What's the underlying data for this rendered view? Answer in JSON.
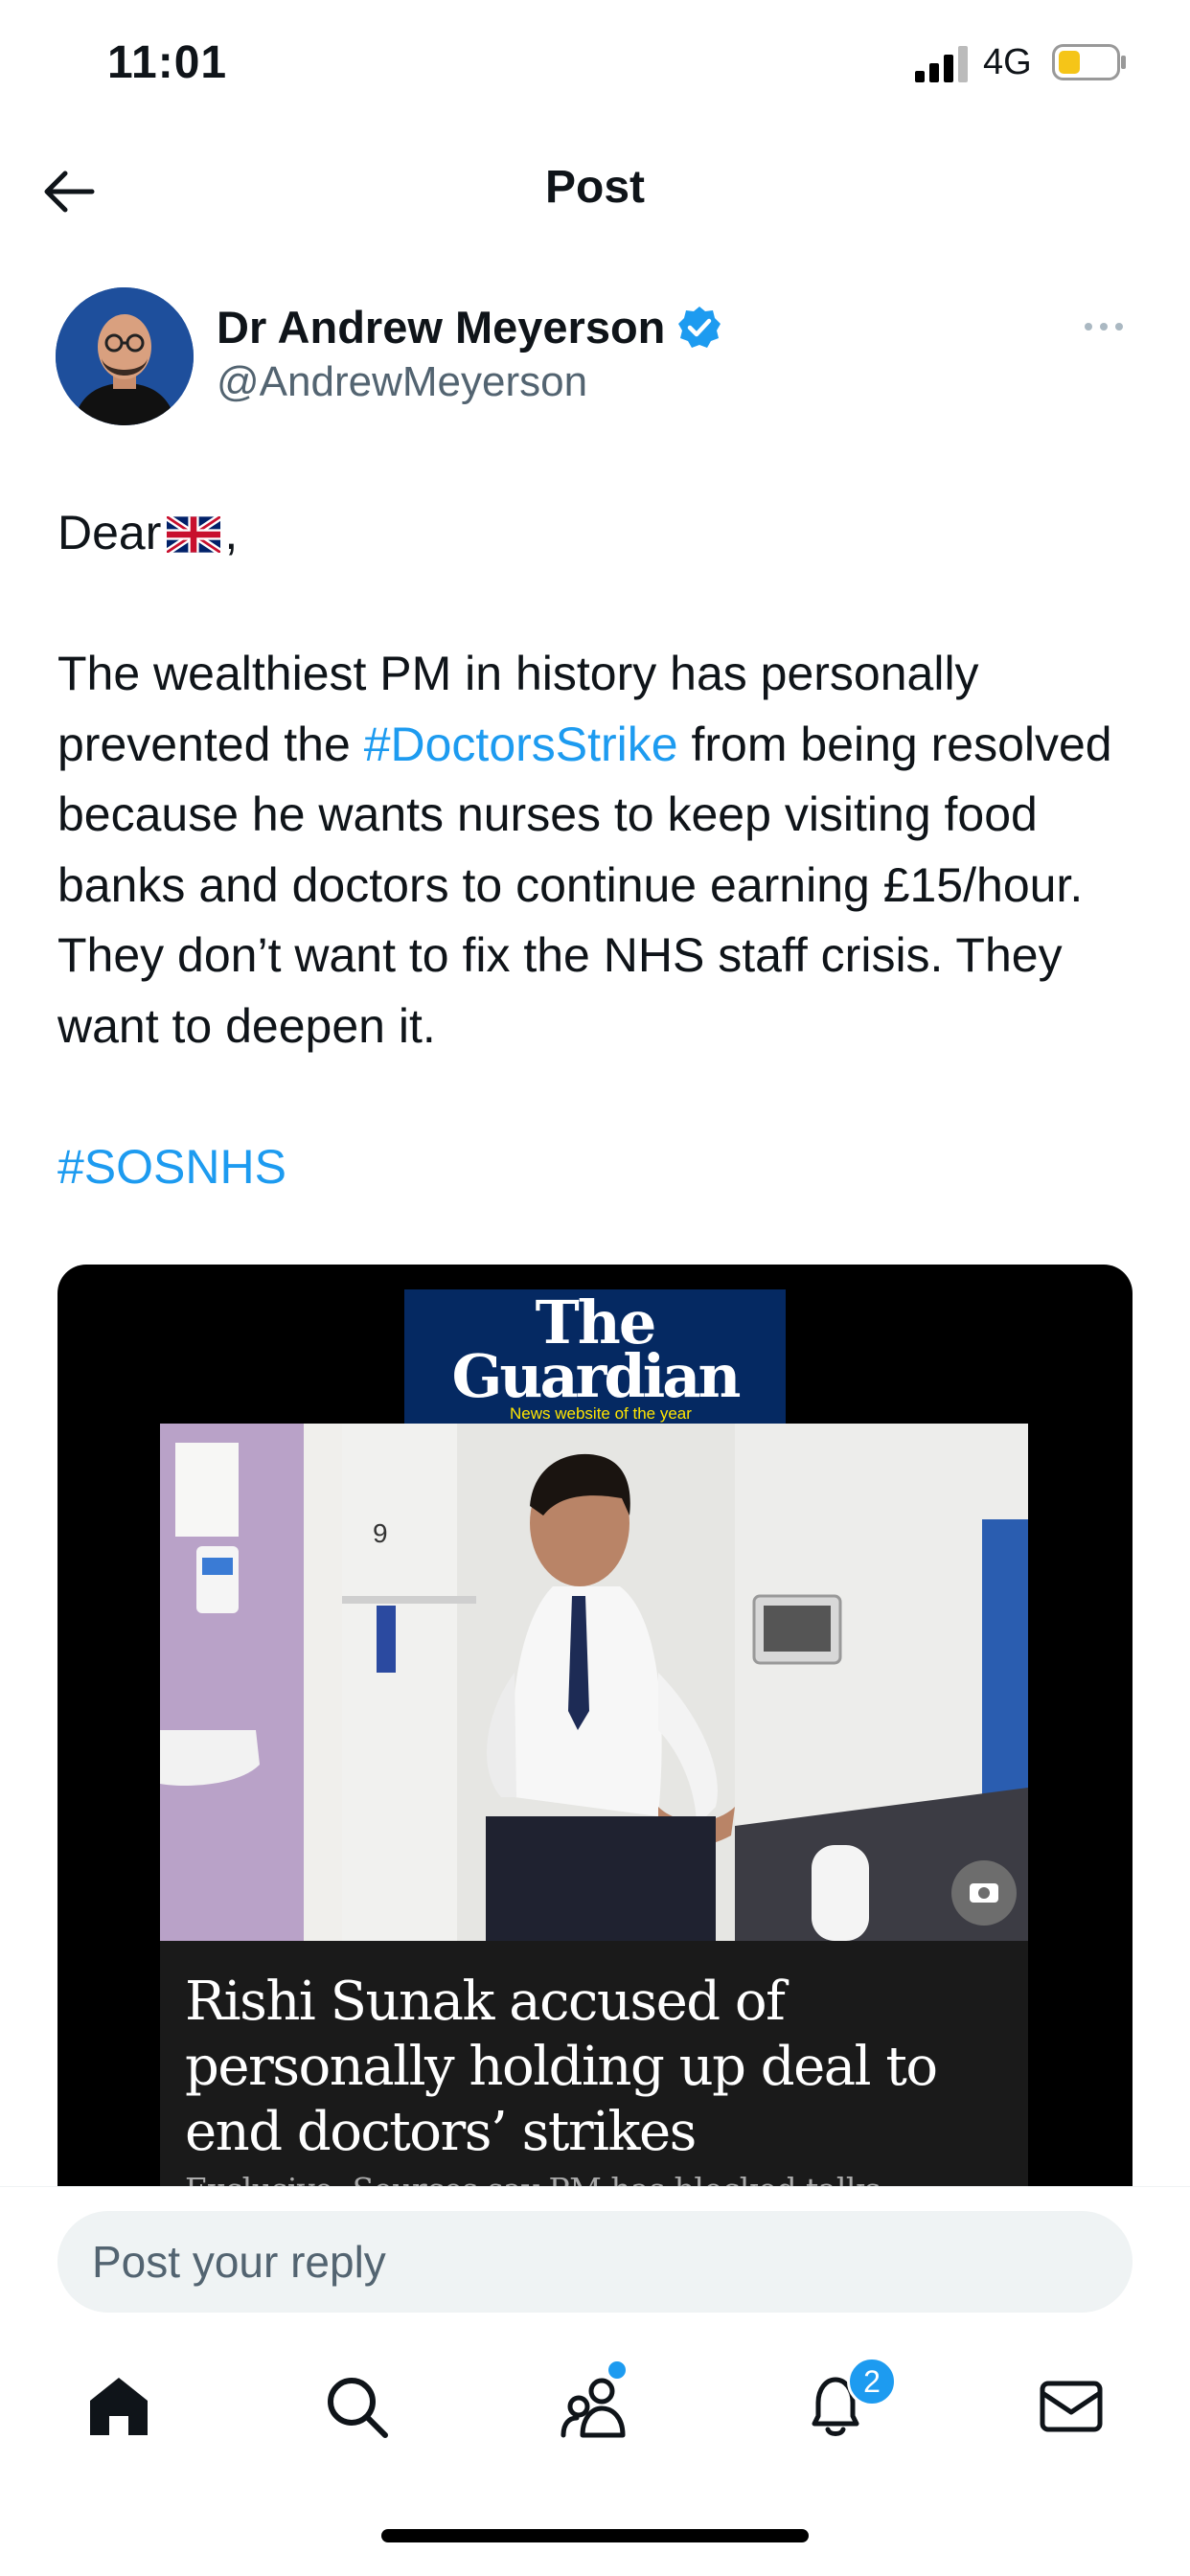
{
  "status_bar": {
    "time": "11:01",
    "network": "4G",
    "battery_color": "#f5c518"
  },
  "header": {
    "title": "Post"
  },
  "author": {
    "name": "Dr Andrew Meyerson",
    "handle": "@AndrewMeyerson",
    "verified": true,
    "avatar_bg": "#1e4f9c"
  },
  "post": {
    "greeting_prefix": "Dear",
    "greeting_suffix": ",",
    "flag_icon": "uk-flag-icon",
    "text_before_hashtag": "The wealthiest PM in history has personally prevented the",
    "hashtag_1": "#DoctorsStrike",
    "text_after_hashtag": "from being resolved because he wants nurses to keep visiting food banks and doctors to continue earning £15/hour. They don’t want to fix the NHS staff crisis. They want to deepen it.",
    "hashtag_2": "#SOSNHS"
  },
  "media": {
    "masthead_line1": "The",
    "masthead_line2": "Guardian",
    "masthead_tagline": "News website of the year",
    "photo_label": "9",
    "headline": "Rishi Sunak accused of personally holding up deal to end doctors’ strikes",
    "standfirst": "Exclusive: Sources say PM has blocked talks"
  },
  "reply": {
    "placeholder": "Post your reply"
  },
  "nav": {
    "items": [
      "home-icon",
      "search-icon",
      "communities-icon",
      "notifications-icon",
      "messages-icon"
    ],
    "notifications_badge": "2"
  },
  "colors": {
    "accent": "#1d9bf0",
    "guardian_blue": "#052962",
    "secondary_text": "#536471"
  }
}
